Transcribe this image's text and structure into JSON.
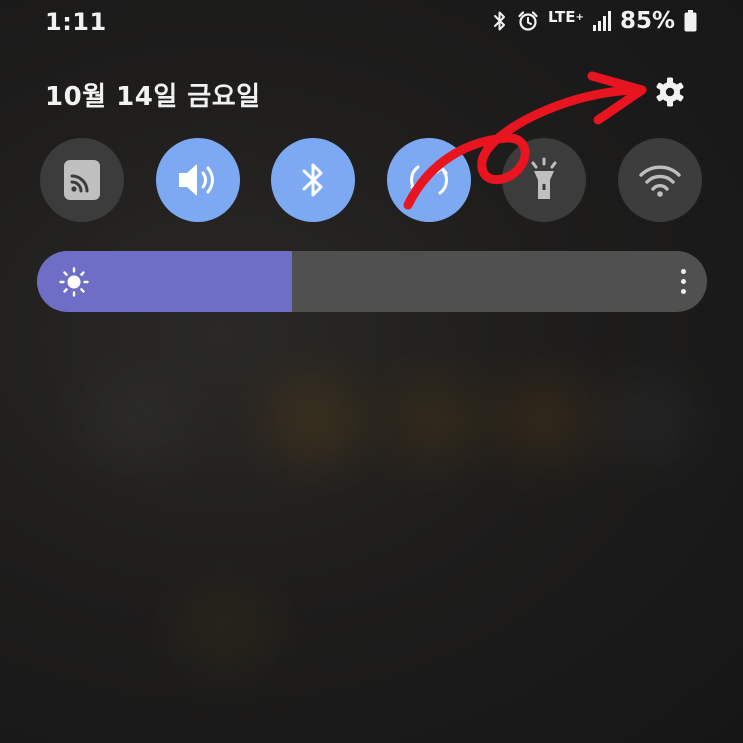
{
  "status_bar": {
    "time": "1:11",
    "network": "LTE",
    "network_sup": "+",
    "battery": "85%",
    "icons": [
      "bluetooth-icon",
      "alarm-icon",
      "lte-icon",
      "signal-icon",
      "battery-icon"
    ]
  },
  "header": {
    "date": "10월 14일 금요일",
    "settings_icon": "gear-icon"
  },
  "quick_tiles": [
    {
      "icon": "cast-icon",
      "state": "off"
    },
    {
      "icon": "sound-icon",
      "state": "on"
    },
    {
      "icon": "bluetooth-icon",
      "state": "on"
    },
    {
      "icon": "auto-rotate-icon",
      "state": "on"
    },
    {
      "icon": "flashlight-icon",
      "state": "off"
    },
    {
      "icon": "wifi-icon",
      "state": "off"
    }
  ],
  "brightness": {
    "level": 0.38,
    "icon": "sun-icon",
    "menu_icon": "more-vertical-icon"
  },
  "colors": {
    "tile_on": "#7da9f2",
    "tile_off": "#3c3c3c",
    "brightness_fill": "#6f6ec7",
    "brightness_track": "#505050",
    "annotation": "#e8141f"
  }
}
